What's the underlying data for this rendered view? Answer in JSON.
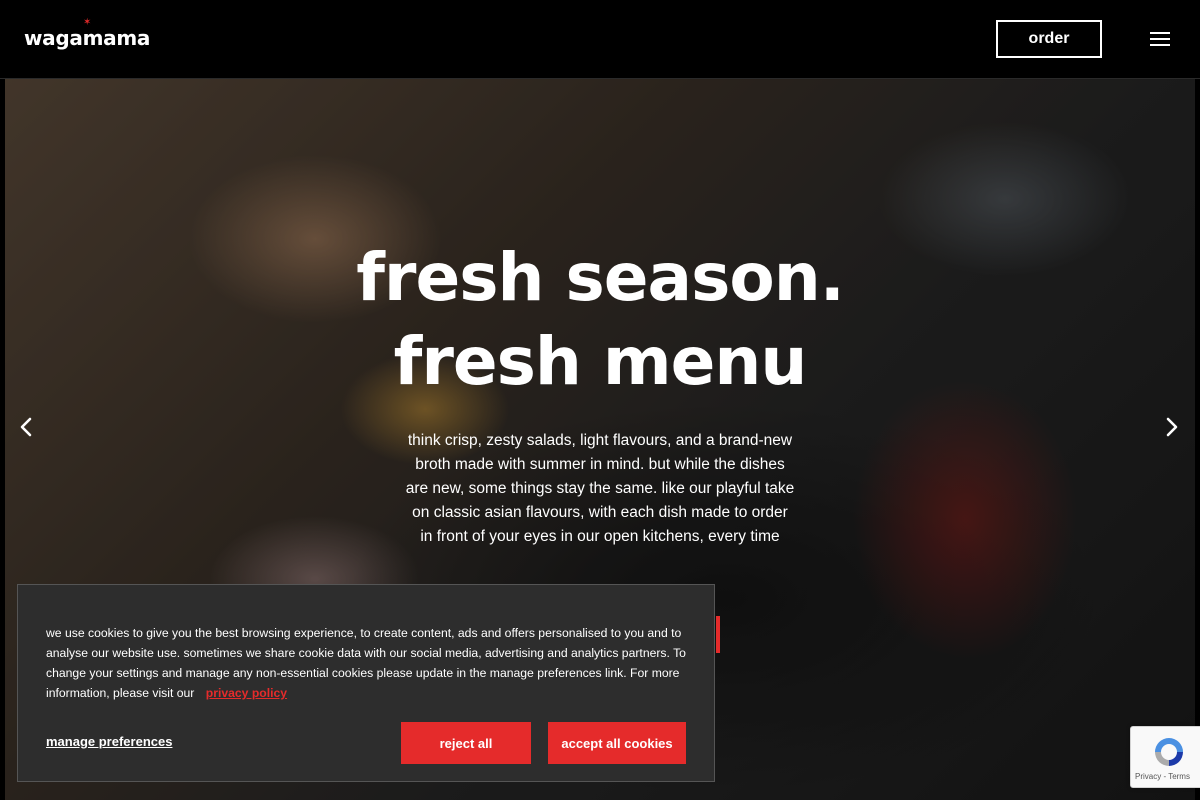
{
  "header": {
    "logo_text": "wagamama",
    "order_label": "order",
    "menu_icon": "hamburger-menu-icon"
  },
  "hero": {
    "headline_line1": "fresh season.",
    "headline_line2": "fresh menu",
    "description": "think crisp, zesty salads, light flavours, and a brand-new broth made with summer in mind. but while the dishes are new, some things stay the same. like our playful take on classic asian flavours, with each dish made to order in front of your eyes in our open kitchens, every time",
    "prev_icon": "chevron-left-icon",
    "next_icon": "chevron-right-icon"
  },
  "cookie_banner": {
    "text": "we use cookies to give you the best browsing experience, to create content, ads and offers personalised to you and to analyse our website use. sometimes we share cookie data with our social media, advertising and analytics partners. To change your settings and manage any non-essential cookies please update in the manage preferences link. For more information, please visit our",
    "privacy_link": "privacy policy",
    "manage_label": "manage preferences",
    "reject_label": "reject all",
    "accept_label": "accept all cookies"
  },
  "recaptcha": {
    "footer_text": "Privacy - Terms"
  },
  "colors": {
    "brand_red": "#e52b2b",
    "header_bg": "#000000",
    "banner_bg": "#2d2d2d"
  }
}
